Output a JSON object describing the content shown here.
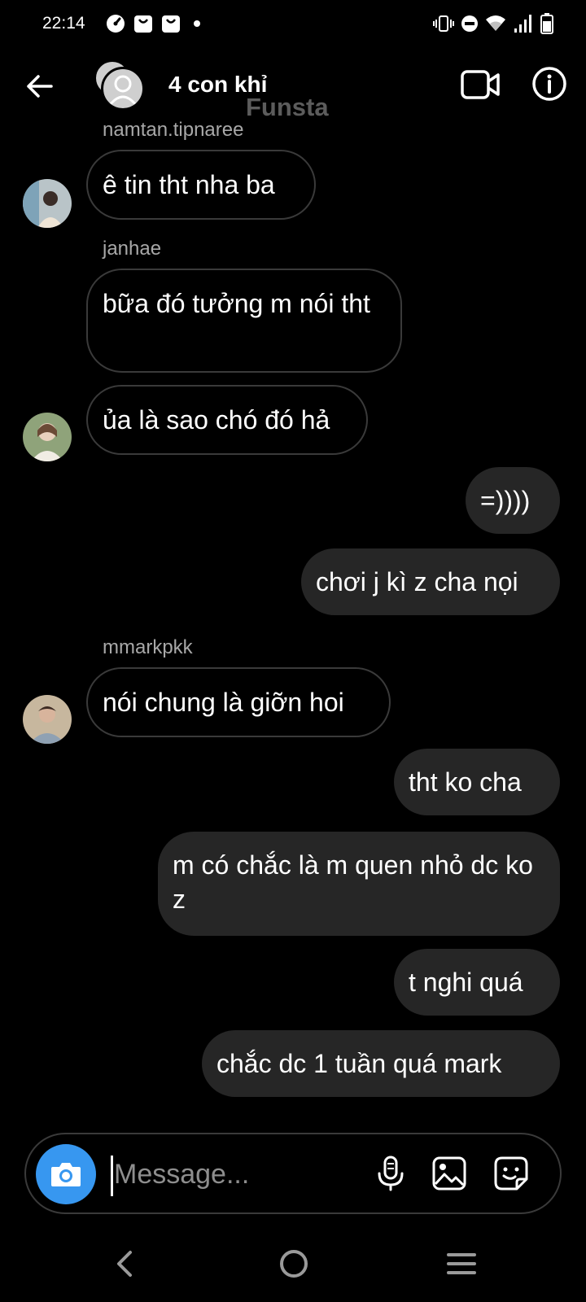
{
  "status_bar": {
    "time": "22:14",
    "notification_icons": [
      "speedometer-icon",
      "shopping-bag-icon",
      "shopping-bag-icon",
      "dot-icon"
    ],
    "system_icons": [
      "vibrate-icon",
      "do-not-disturb-icon",
      "wifi-icon",
      "signal-icon",
      "battery-icon"
    ]
  },
  "header": {
    "title": "4 con khỉ",
    "subtitle": "Funsta"
  },
  "messages": [
    {
      "sender": "namtan.tipnaree",
      "text": "ê tin tht nha ba",
      "direction": "in"
    },
    {
      "sender": "janhae",
      "text": "bữa đó tưởng m nói tht",
      "direction": "in"
    },
    {
      "sender": "",
      "text": "ủa là sao chó đó hả",
      "direction": "in"
    },
    {
      "sender": "",
      "text": "=))))",
      "direction": "out"
    },
    {
      "sender": "",
      "text": "chơi j kì z cha nọi",
      "direction": "out"
    },
    {
      "sender": "mmarkpkk",
      "text": "nói chung là giỡn hoi",
      "direction": "in"
    },
    {
      "sender": "",
      "text": "tht ko cha",
      "direction": "out"
    },
    {
      "sender": "",
      "text": "m có chắc là m quen nhỏ dc ko z",
      "direction": "out"
    },
    {
      "sender": "",
      "text": "t nghi quá",
      "direction": "out"
    },
    {
      "sender": "",
      "text": "chắc dc 1 tuần quá mark",
      "direction": "out"
    }
  ],
  "composer": {
    "placeholder": "Message...",
    "value": ""
  },
  "colors": {
    "background": "#000000",
    "outgoing_bubble": "#262626",
    "incoming_border": "#3a3a3a",
    "sender_name": "#a8a8a8",
    "accent": "#3797f0",
    "subtitle": "#5c5c5c"
  }
}
